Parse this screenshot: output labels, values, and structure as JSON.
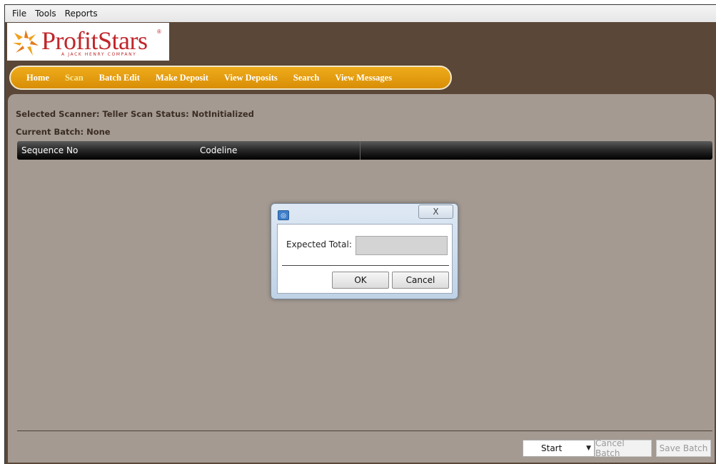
{
  "menubar": {
    "items": [
      "File",
      "Tools",
      "Reports"
    ]
  },
  "logo": {
    "name": "ProfitStars",
    "registered": "®",
    "tagline": "A JACK HENRY COMPANY"
  },
  "nav": {
    "items": [
      "Home",
      "Scan",
      "Batch Edit",
      "Make Deposit",
      "View Deposits",
      "Search",
      "View Messages"
    ],
    "active": "Scan"
  },
  "scan": {
    "scanner_line": "Selected Scanner: Teller Scan  Status: NotInitialized",
    "batch_label": "Current Batch:",
    "batch_value": "None"
  },
  "grid": {
    "columns": [
      "Sequence No",
      "Codeline"
    ]
  },
  "bottom": {
    "start_label": "Start",
    "cancel_batch_label": "Cancel Batch",
    "save_batch_label": "Save Batch"
  },
  "dialog": {
    "close_glyph": "X",
    "field_label": "Expected Total:",
    "field_value": "",
    "ok_label": "OK",
    "cancel_label": "Cancel"
  },
  "colors": {
    "brand_red": "#c0262b",
    "nav_orange": "#e29a0f",
    "frame_brown": "#5a4738",
    "content_bg": "#a49a92"
  }
}
